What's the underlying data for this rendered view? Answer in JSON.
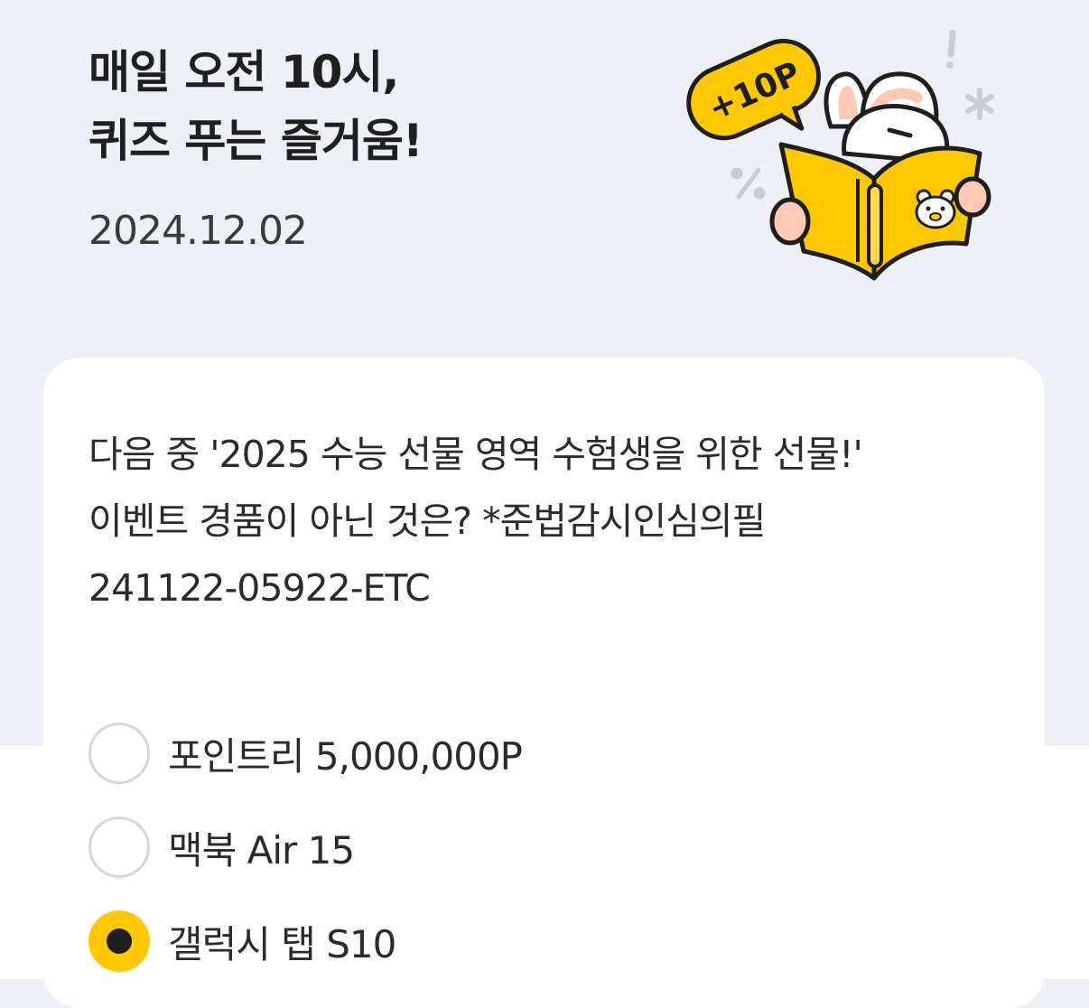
{
  "header": {
    "title_line1": "매일 오전 10시,",
    "title_line2": "퀴즈 푸는 즐거움!",
    "date": "2024.12.02",
    "badge_text": "+10P"
  },
  "quiz": {
    "question_line1": "다음 중 '2025 수능 선물 영역 수험생을 위한 선물!'",
    "question_line2": "이벤트 경품이 아닌 것은? *준법감시인심의필",
    "question_line3": "241122-05922-ETC",
    "options": [
      {
        "label": "포인트리 5,000,000P",
        "selected": false
      },
      {
        "label": "맥북 Air 15",
        "selected": false
      },
      {
        "label": "갤럭시 탭 S10",
        "selected": true
      }
    ]
  },
  "colors": {
    "background": "#edf0f5",
    "card": "#ffffff",
    "accent_yellow": "#ffc800",
    "text": "#222222",
    "radio_border": "#d6d6d6"
  }
}
